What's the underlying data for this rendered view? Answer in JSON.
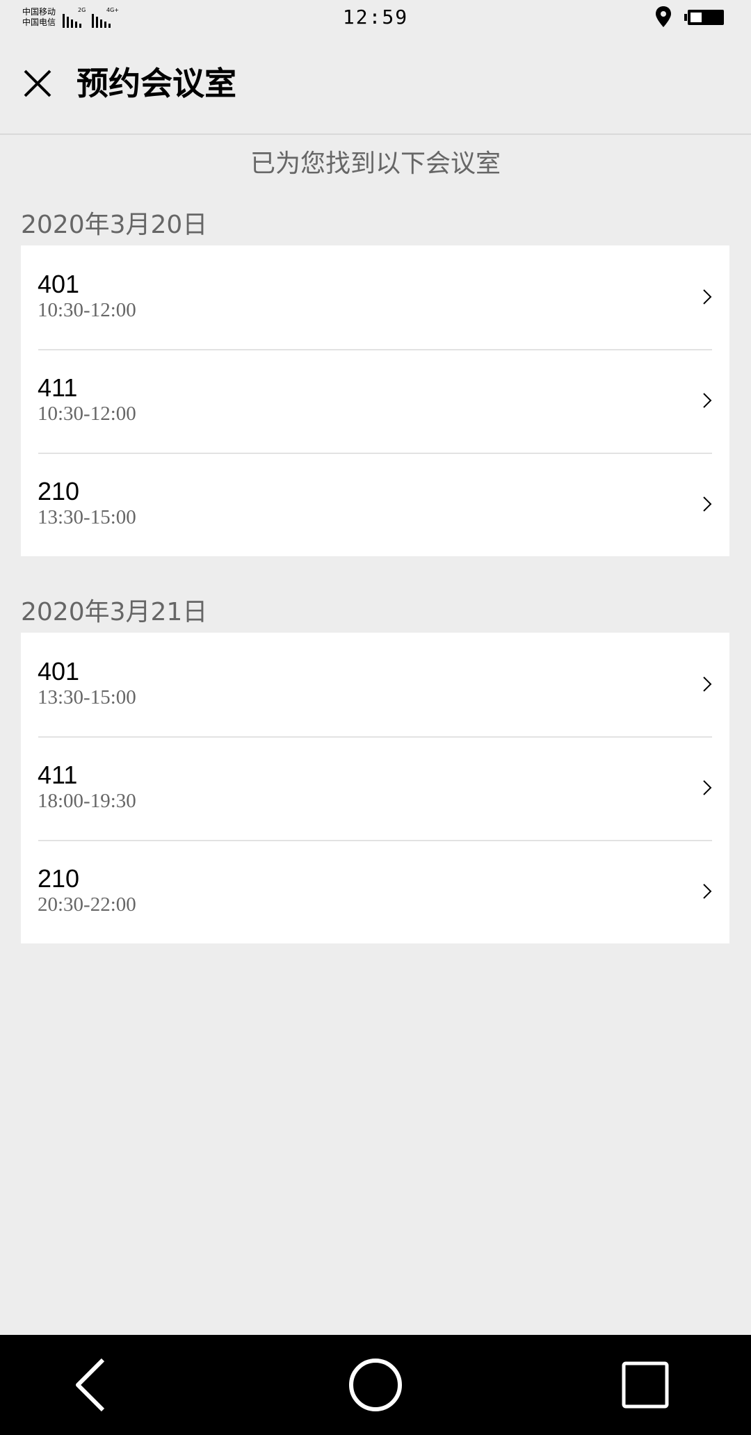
{
  "status_bar": {
    "carrier_1": "中国移动",
    "carrier_2": "中国电信",
    "net_1": "2G",
    "net_2": "4G+",
    "time": "12:59"
  },
  "header": {
    "title": "预约会议室"
  },
  "subtitle": "已为您找到以下会议室",
  "groups": [
    {
      "date": "2020年3月20日",
      "rooms": [
        {
          "room": "401",
          "time": "10:30-12:00"
        },
        {
          "room": "411",
          "time": "10:30-12:00"
        },
        {
          "room": "210",
          "time": "13:30-15:00"
        }
      ]
    },
    {
      "date": "2020年3月21日",
      "rooms": [
        {
          "room": "401",
          "time": "13:30-15:00"
        },
        {
          "room": "411",
          "time": "18:00-19:30"
        },
        {
          "room": "210",
          "time": "20:30-22:00"
        }
      ]
    }
  ],
  "icons": {
    "close": "close-icon",
    "chevron": "chevron-right-icon",
    "nav_back": "triangle-back-icon",
    "nav_home": "circle-home-icon",
    "nav_recent": "square-recent-icon"
  }
}
